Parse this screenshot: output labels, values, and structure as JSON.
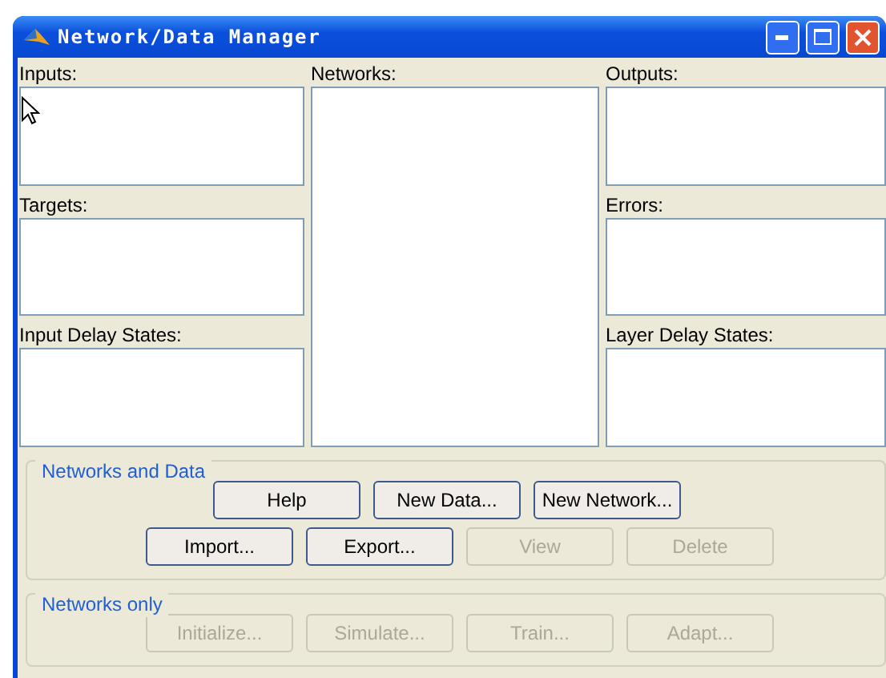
{
  "window": {
    "title": "Network/Data Manager"
  },
  "left_lists": [
    {
      "label": "Inputs:"
    },
    {
      "label": "Targets:"
    },
    {
      "label": "Input Delay States:"
    }
  ],
  "center_list": {
    "label": "Networks:"
  },
  "right_lists": [
    {
      "label": "Outputs:"
    },
    {
      "label": "Errors:"
    },
    {
      "label": "Layer Delay States:"
    }
  ],
  "groups": [
    {
      "title": "Networks and Data",
      "rows": [
        [
          {
            "label": "Help",
            "disabled": false
          },
          {
            "label": "New Data...",
            "disabled": false
          },
          {
            "label": "New Network...",
            "disabled": false
          }
        ],
        [
          {
            "label": "Import...",
            "disabled": false
          },
          {
            "label": "Export...",
            "disabled": false
          },
          {
            "label": "View",
            "disabled": true
          },
          {
            "label": "Delete",
            "disabled": true
          }
        ]
      ]
    },
    {
      "title": "Networks only",
      "rows": [
        [
          {
            "label": "Initialize...",
            "disabled": true
          },
          {
            "label": "Simulate...",
            "disabled": true
          },
          {
            "label": "Train...",
            "disabled": true
          },
          {
            "label": "Adapt...",
            "disabled": true
          }
        ]
      ]
    }
  ]
}
